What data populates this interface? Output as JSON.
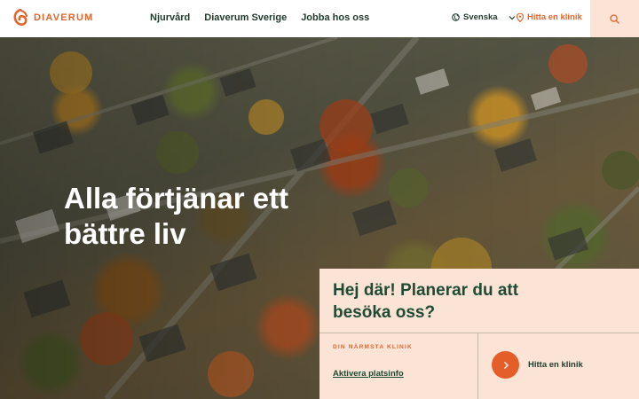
{
  "brand": {
    "name": "DIAVERUM",
    "accent": "#e0662d",
    "dark_green": "#1f4a34",
    "panel_bg": "#fbe4d6"
  },
  "nav": {
    "items": [
      "Njurvård",
      "Diaverum Sverige",
      "Jobba hos oss"
    ]
  },
  "language": {
    "label": "Svenska",
    "icon": "globe-icon"
  },
  "find_clinic": {
    "label": "Hitta en klinik",
    "icon": "location-pin-icon"
  },
  "search": {
    "icon": "search-icon"
  },
  "hero": {
    "headline": "Alla förtjänar ett bättre liv",
    "image": "aerial-neighborhood-autumn"
  },
  "clinic_panel": {
    "title": "Hej där! Planerar du att besöka oss?",
    "kicker": "DIN NÄRMSTA KLINIK",
    "activate_link": "Aktivera platsinfo",
    "button_label": "Hitta en klinik"
  }
}
